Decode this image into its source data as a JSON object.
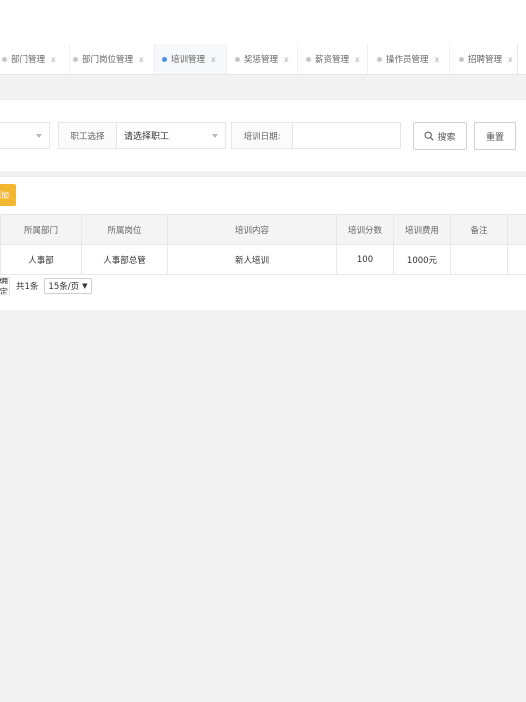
{
  "tabs": [
    {
      "label": "部门管理",
      "active": false
    },
    {
      "label": "部门岗位管理",
      "active": false
    },
    {
      "label": "培训管理",
      "active": true
    },
    {
      "label": "奖惩管理",
      "active": false
    },
    {
      "label": "薪资管理",
      "active": false
    },
    {
      "label": "操作员管理",
      "active": false
    },
    {
      "label": "招聘管理",
      "active": false
    }
  ],
  "tab_close": "x",
  "filter": {
    "employee_label": "职工选择",
    "employee_value": "请选择职工",
    "date_label": "培训日期:",
    "search_button": "搜索",
    "reset_button": "重置"
  },
  "add_button": "添加",
  "table": {
    "headers": [
      "所属部门",
      "所属岗位",
      "培训内容",
      "培训分数",
      "培训费用",
      "备注"
    ],
    "rows": [
      [
        "人事部",
        "人事部总管",
        "新人培训",
        "100",
        "1000元",
        ""
      ]
    ]
  },
  "pager": {
    "confirm": "确定",
    "total": "共1条",
    "page_size": "15条/页"
  }
}
